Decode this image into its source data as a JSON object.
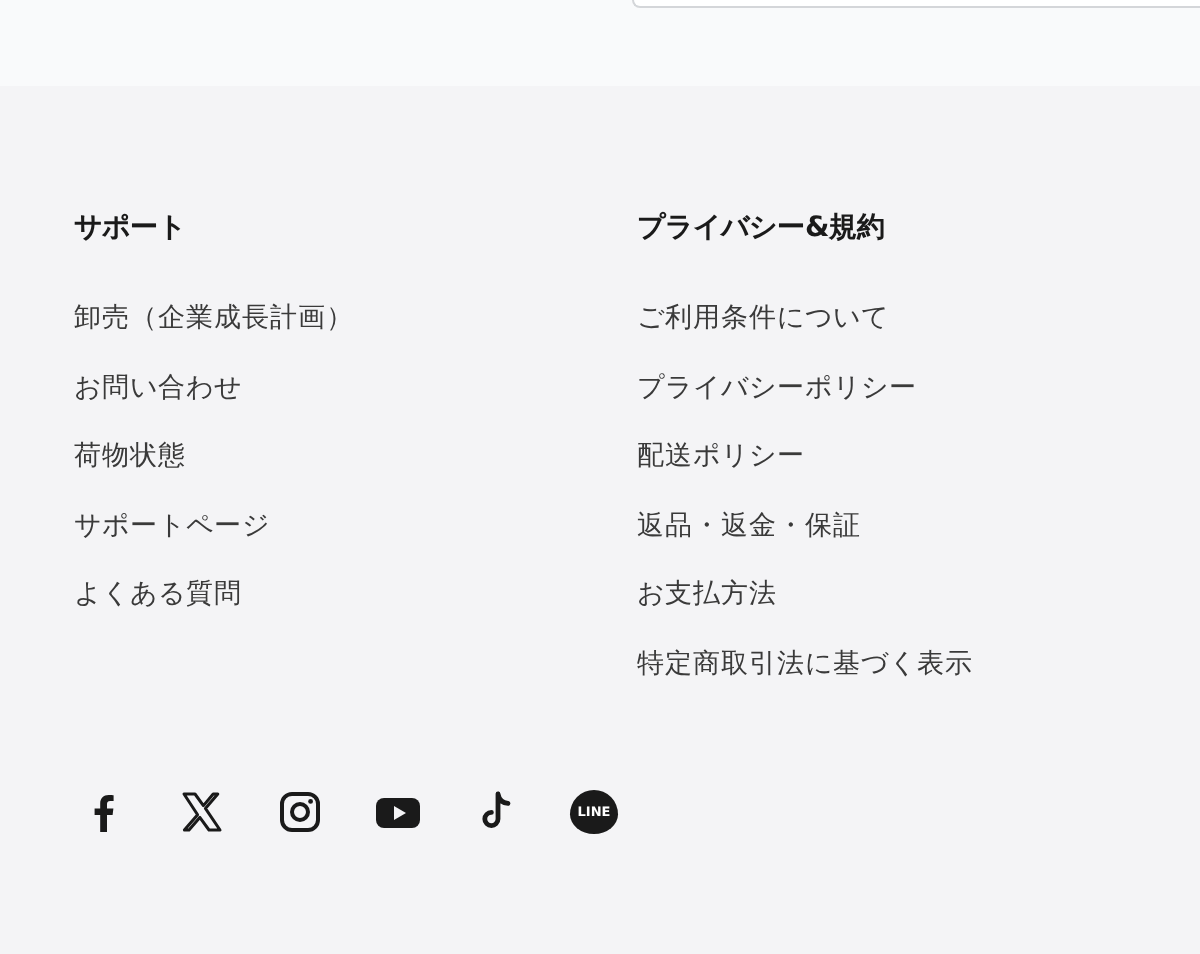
{
  "columns": [
    {
      "heading": "サポート",
      "links": [
        "卸売（企業成長計画）",
        "お問い合わせ",
        "荷物状態",
        "サポートページ",
        "よくある質問"
      ]
    },
    {
      "heading": "プライバシー&規約",
      "links": [
        "ご利用条件について",
        "プライバシーポリシー",
        "配送ポリシー",
        "返品・返金・保証",
        "お支払方法",
        "特定商取引法に基づく表示"
      ]
    }
  ],
  "social": [
    {
      "kind": "facebook"
    },
    {
      "kind": "x"
    },
    {
      "kind": "instagram"
    },
    {
      "kind": "youtube"
    },
    {
      "kind": "tiktok"
    },
    {
      "kind": "line",
      "label": "LINE"
    }
  ]
}
